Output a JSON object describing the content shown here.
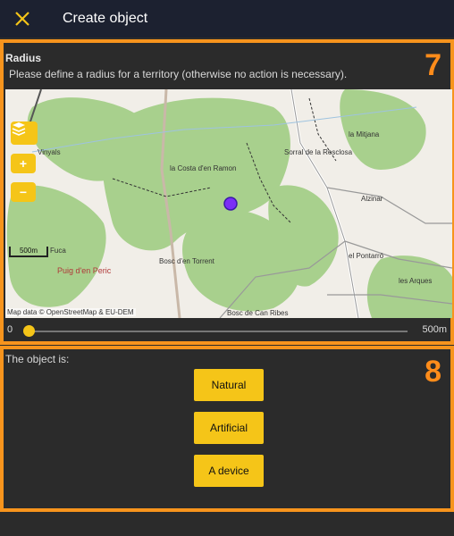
{
  "header": {
    "title": "Create object",
    "close_icon": "close-icon"
  },
  "radius_panel": {
    "badge": "7",
    "label": "Radius",
    "help": "Please define a radius for a territory (otherwise no action is necessary).",
    "map": {
      "attribution": "Map data © OpenStreetMap & EU-DEM",
      "scale": "500m",
      "places": [
        "Vinyals",
        "la Costa d'en Ramon",
        "Sorral de la Resclosa",
        "la Mitjana",
        "Alzinar",
        "Puig d'en Peric",
        "Bosc d'en Torrent",
        "el Pontarró",
        "les Arques",
        "Bosc de Can Ribes",
        "Fuca"
      ],
      "controls": {
        "layers_icon": "layers-icon",
        "zoom_in": "+",
        "zoom_out": "−"
      },
      "marker_color": "#7b2ff7"
    },
    "slider": {
      "min_label": "0",
      "max_label": "500m",
      "value": 0
    }
  },
  "object_panel": {
    "badge": "8",
    "label": "The object is:",
    "options": [
      "Natural",
      "Artificial",
      "A device"
    ]
  },
  "colors": {
    "accent": "#f5c518",
    "highlight_border": "#f7941d",
    "header_bg": "#1c2130",
    "panel_bg": "#2b2b2b"
  }
}
